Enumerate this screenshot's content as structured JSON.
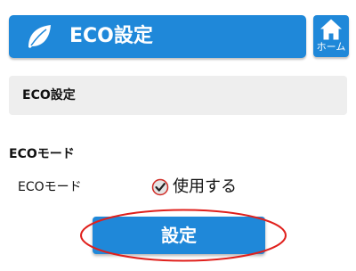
{
  "header": {
    "title": "ECO設定",
    "icon": "leaf-icon",
    "home_label": "ホーム",
    "home_icon": "home-icon",
    "accent_color": "#1f88d9"
  },
  "section": {
    "title": "ECO設定"
  },
  "eco_mode": {
    "heading": "ECOモード",
    "label": "ECOモード",
    "checkbox_label": "使用する",
    "checked": true
  },
  "actions": {
    "submit_label": "設定"
  },
  "annotation": {
    "highlight_color": "#e0201c"
  }
}
